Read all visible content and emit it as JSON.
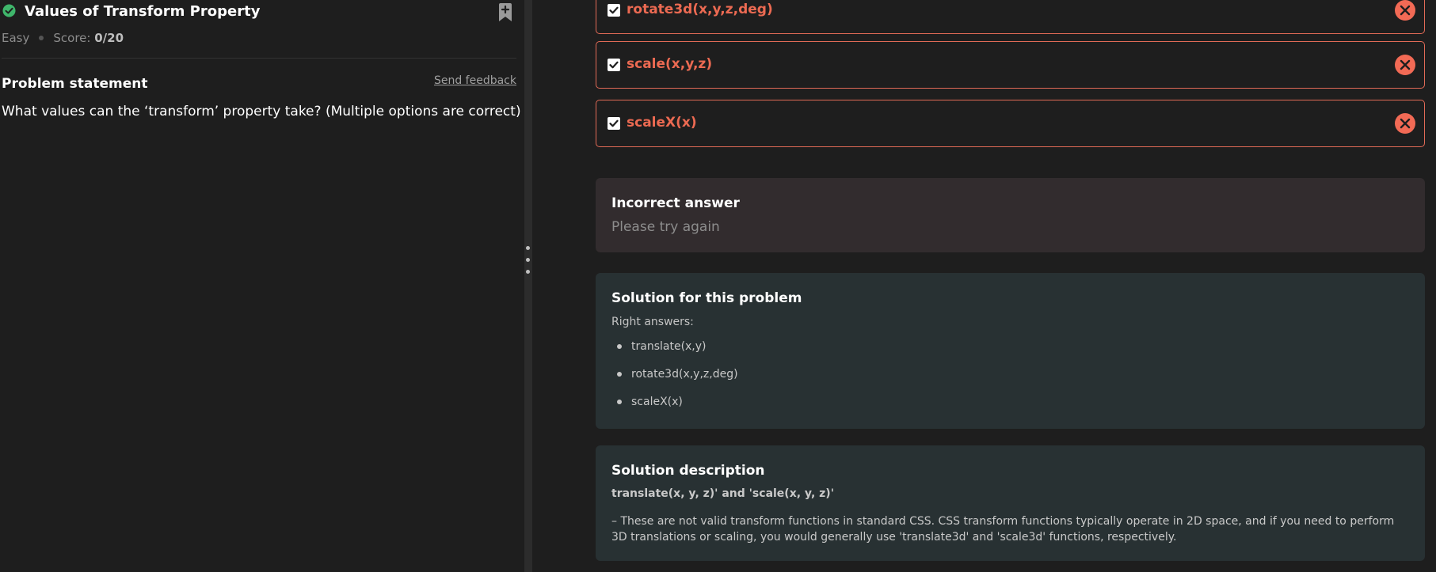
{
  "problem": {
    "title": "Values of Transform Property",
    "difficulty": "Easy",
    "score_label": "Score:",
    "score_value": "0/20",
    "statement_title": "Problem statement",
    "feedback_link": "Send feedback",
    "question": "What values can the ‘transform’ property take? (Multiple options are correct)"
  },
  "options": [
    {
      "label": "rotate3d(x,y,z,deg)",
      "checked": true,
      "status": "incorrect"
    },
    {
      "label": "scale(x,y,z)",
      "checked": true,
      "status": "incorrect"
    },
    {
      "label": "scaleX(x)",
      "checked": true,
      "status": "incorrect"
    }
  ],
  "result": {
    "title": "Incorrect answer",
    "subtitle": "Please try again"
  },
  "solution": {
    "title": "Solution for this problem",
    "right_answers_label": "Right answers:",
    "answers": [
      "translate(x,y)",
      "rotate3d(x,y,z,deg)",
      "scaleX(x)"
    ]
  },
  "description": {
    "title": "Solution description",
    "subtitle": "translate(x, y, z)' and 'scale(x, y, z)'",
    "body": "– These are not valid transform functions in standard CSS. CSS transform functions typically operate in 2D space, and if you need to perform 3D translations or scaling, you would generally use 'translate3d' and 'scale3d' functions, respectively."
  },
  "colors": {
    "accent_error": "#f26a55",
    "success": "#3fb66b",
    "background": "#1e1e1e",
    "card": "#283133"
  }
}
